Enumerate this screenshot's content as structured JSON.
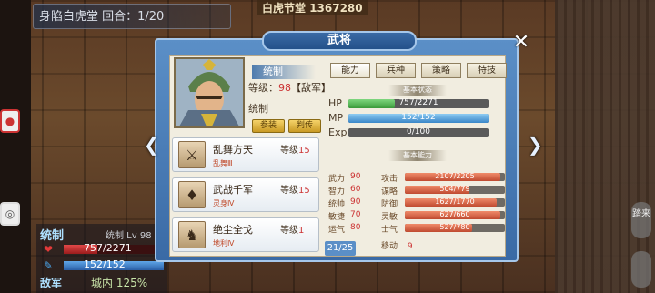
{
  "banner": {
    "text": "身陷白虎堂 回合：1/20"
  },
  "hall": {
    "title": "白虎节堂 1367280"
  },
  "unit": {
    "name": "统制",
    "level": "统制 Lv 98",
    "hp": "757/2271",
    "hp_fraction": 0.333,
    "mp": "152/152",
    "mp_fraction": 1.0,
    "faction": "敌军",
    "terrain": "城内 125%"
  },
  "dialog": {
    "title": "武将",
    "close_icon": "close-icon",
    "name": "统制",
    "level_label": "等级：",
    "level_value": "98",
    "team": "【敌军】",
    "general_title": "统制",
    "buttons": {
      "join": "参装",
      "judge": "判传"
    },
    "tabs": [
      "能力",
      "兵种",
      "策略",
      "特技"
    ],
    "active_tab": 0,
    "section_status": "基本状态",
    "section_ability": "基本能力",
    "page": "21/25"
  },
  "status": {
    "hp": {
      "label": "HP",
      "text": "757/2271",
      "fraction": 0.333
    },
    "mp": {
      "label": "MP",
      "text": "152/152",
      "fraction": 1.0
    },
    "exp": {
      "label": "Exp",
      "text": "0/100",
      "fraction": 0.0
    }
  },
  "abilities": [
    {
      "name": "武力",
      "val": "90",
      "name2": "攻击",
      "text": "2107/2205",
      "fraction": 0.955
    },
    {
      "name": "智力",
      "val": "60",
      "name2": "谋略",
      "text": "504/779",
      "fraction": 0.647
    },
    {
      "name": "统帅",
      "val": "90",
      "name2": "防御",
      "text": "1627/1770",
      "fraction": 0.919
    },
    {
      "name": "敏捷",
      "val": "70",
      "name2": "灵敏",
      "text": "627/660",
      "fraction": 0.95
    },
    {
      "name": "运气",
      "val": "80",
      "name2": "士气",
      "text": "527/780",
      "fraction": 0.676
    }
  ],
  "move": {
    "label": "移动",
    "value": "9"
  },
  "skills": [
    {
      "name": "乱舞方天",
      "level_label": "等级",
      "level": "15",
      "type": "乱舞Ⅲ",
      "icon": "halberd-icon"
    },
    {
      "name": "武战千军",
      "level_label": "等级",
      "level": "15",
      "type": "灵身Ⅳ",
      "icon": "armor-icon"
    },
    {
      "name": "绝尘全戈",
      "level_label": "等级",
      "level": "1",
      "type": "地利Ⅳ",
      "icon": "horse-icon"
    }
  ],
  "colors": {
    "hp": "#4caf50",
    "mp": "#4a9ad8",
    "accent": "#3a6aa5",
    "level_red": "#cc3333"
  },
  "right_side": {
    "btn1": "踏来",
    "btn2": ""
  }
}
